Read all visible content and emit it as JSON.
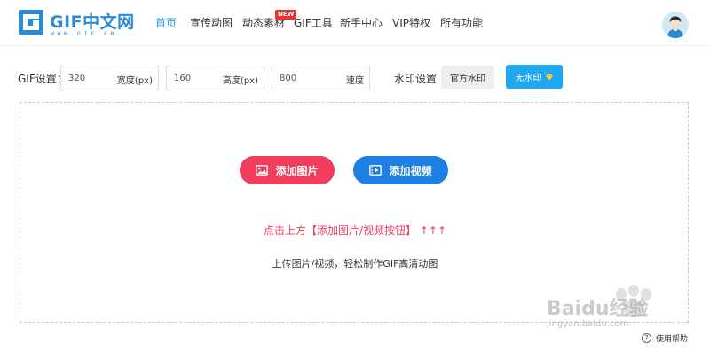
{
  "header": {
    "logo": {
      "name": "GIF中文网",
      "sub": "WWW.GIF.CN"
    },
    "nav": [
      {
        "label": "首页",
        "active": true
      },
      {
        "label": "宣传动图"
      },
      {
        "label": "动态素材",
        "badge": "NEW"
      },
      {
        "label": "GIF工具"
      },
      {
        "label": "新手中心"
      },
      {
        "label": "VIP特权"
      },
      {
        "label": "所有功能"
      }
    ]
  },
  "settings": {
    "label": "GIF设置：",
    "width": {
      "value": "320",
      "unit": "宽度(px)"
    },
    "height": {
      "value": "160",
      "unit": "高度(px)"
    },
    "speed": {
      "value": "800",
      "unit": "速度"
    },
    "watermark_label": "水印设置",
    "official_watermark": "官方水印",
    "no_watermark": "无水印"
  },
  "upload": {
    "add_image": "添加图片",
    "add_video": "添加视频",
    "hint": "点击上方【添加图片/视频按钮】 ↑↑↑",
    "subhint": "上传图片/视频，轻松制作GIF高清动图"
  },
  "watermark": {
    "brand": "Baidu经验",
    "url": "jingyan.baidu.com"
  },
  "help": {
    "label": "使用帮助"
  },
  "colors": {
    "accent": "#1aa1e6",
    "image_button": "#f13c5b",
    "video_button": "#1e80e3",
    "new_badge": "#e8352c"
  }
}
